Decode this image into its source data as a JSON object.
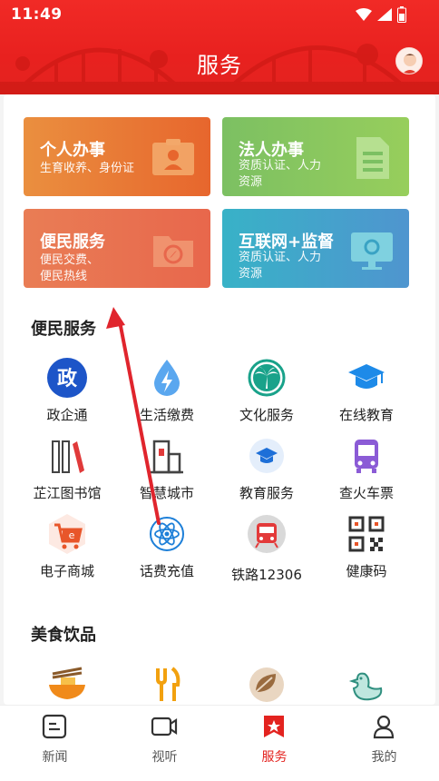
{
  "status": {
    "time": "11:49"
  },
  "header": {
    "title": "服务"
  },
  "cards": [
    {
      "title": "个人办事",
      "subtitle": "生育收养、身份证",
      "color": "#e7662d"
    },
    {
      "title": "法人办事",
      "subtitle": "资质认证、人力资源",
      "subtitle_lines": [
        "资质认证、人力",
        "资源"
      ],
      "color": "#7cc062"
    },
    {
      "title": "便民服务",
      "subtitle_lines": [
        "便民交费、",
        "便民热线"
      ],
      "color": "#e8674c"
    },
    {
      "title": "互联网+监督",
      "subtitle_lines": [
        "资质认证、人力",
        "资源"
      ],
      "color": "#4f95cf"
    }
  ],
  "sections": {
    "convenience": {
      "title": "便民服务",
      "items": [
        {
          "label": "政企通",
          "icon": "gov-badge-icon"
        },
        {
          "label": "生活缴费",
          "icon": "water-drop-bolt-icon"
        },
        {
          "label": "文化服务",
          "icon": "palm-tree-icon"
        },
        {
          "label": "在线教育",
          "icon": "graduation-cap-icon"
        },
        {
          "label": "芷江图书馆",
          "icon": "books-icon"
        },
        {
          "label": "智慧城市",
          "icon": "building-icon"
        },
        {
          "label": "教育服务",
          "icon": "education-cap-circle-icon"
        },
        {
          "label": "查火车票",
          "icon": "bus-icon"
        },
        {
          "label": "电子商城",
          "icon": "shopping-cart-icon"
        },
        {
          "label": "话费充值",
          "icon": "atom-icon"
        },
        {
          "label": "铁路12306",
          "icon": "train-icon"
        },
        {
          "label": "健康码",
          "icon": "qr-code-icon"
        }
      ]
    },
    "food": {
      "title": "美食饮品",
      "items": [
        {
          "label": "",
          "icon": "noodle-bowl-icon"
        },
        {
          "label": "",
          "icon": "fork-knife-icon"
        },
        {
          "label": "",
          "icon": "tea-leaf-icon"
        },
        {
          "label": "",
          "icon": "duck-icon"
        }
      ]
    }
  },
  "bottom_nav": [
    {
      "label": "新闻",
      "icon": "news-icon",
      "active": false
    },
    {
      "label": "视听",
      "icon": "video-camera-icon",
      "active": false
    },
    {
      "label": "服务",
      "icon": "service-star-icon",
      "active": true
    },
    {
      "label": "我的",
      "icon": "profile-icon",
      "active": false
    }
  ],
  "colors": {
    "brand": "#e3231f",
    "white": "#ffffff"
  }
}
